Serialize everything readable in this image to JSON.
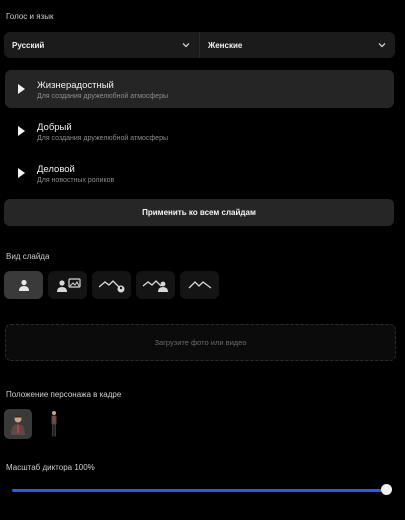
{
  "voice_section": {
    "title": "Голос и язык",
    "language_select": "Русский",
    "gender_select": "Женские"
  },
  "voices": [
    {
      "name": "Жизнерадостный",
      "description": "Для создания дружелюбной атмосферы",
      "active": true
    },
    {
      "name": "Добрый",
      "description": "Для создания дружелюбной атмосферы",
      "active": false
    },
    {
      "name": "Деловой",
      "description": "Для новостных роликов",
      "active": false
    }
  ],
  "apply_button": "Применить ко всем слайдам",
  "slide_view": {
    "title": "Вид слайда",
    "options": [
      "avatar-only",
      "avatar-with-image",
      "background-with-avatar",
      "background-with-group",
      "background-only"
    ],
    "selected": "avatar-only"
  },
  "upload": {
    "label": "Загрузите фото или видео"
  },
  "position_section": {
    "title": "Положение персонажа в кадре",
    "options": [
      "half-body",
      "full-body"
    ],
    "selected": "half-body"
  },
  "scale": {
    "label": "Масштаб диктора 100%",
    "value_percent": 100
  },
  "colors": {
    "accent": "#2d5be3",
    "background": "#000000",
    "panel": "#1b1b1b"
  }
}
